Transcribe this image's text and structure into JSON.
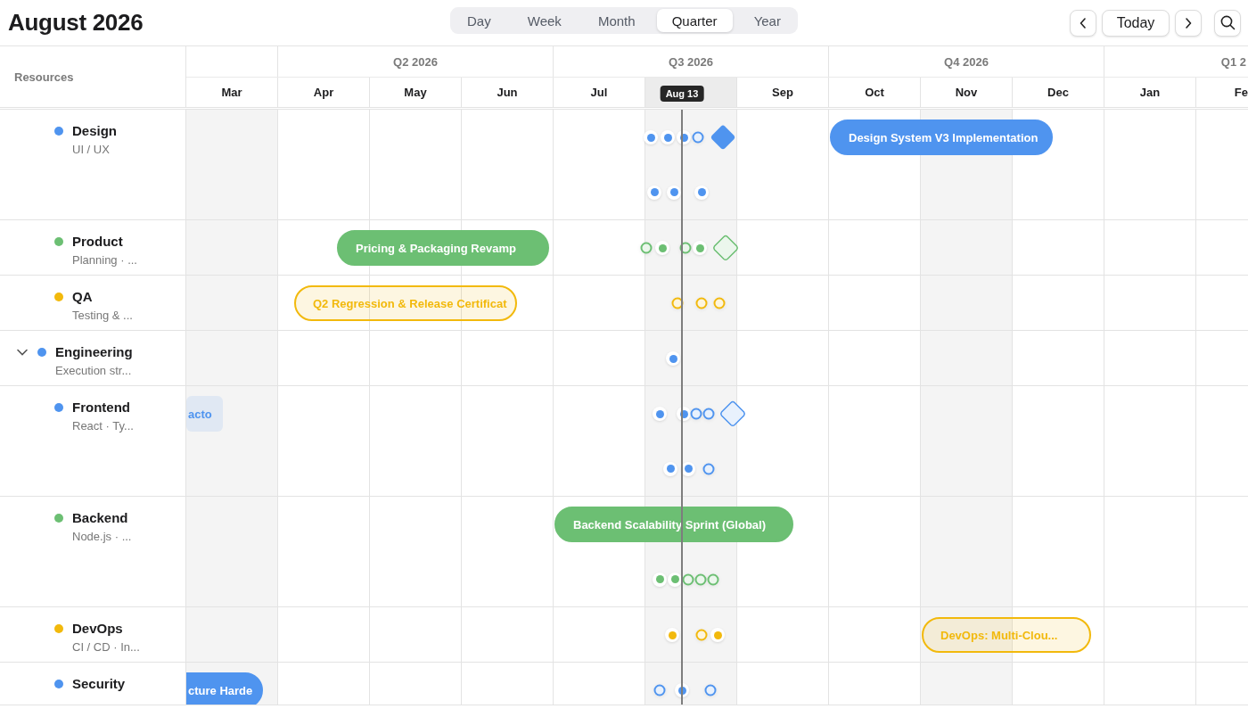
{
  "header": {
    "title": "August 2026"
  },
  "views": [
    {
      "label": "Day",
      "selected": false
    },
    {
      "label": "Week",
      "selected": false
    },
    {
      "label": "Month",
      "selected": false
    },
    {
      "label": "Quarter",
      "selected": true
    },
    {
      "label": "Year",
      "selected": false
    }
  ],
  "nav": {
    "today": "Today"
  },
  "resources_heading": "Resources",
  "quarters": [
    {
      "months": [
        {
          "label": "Mar",
          "shaded": true,
          "current": false
        }
      ]
    },
    {
      "label": "Q2 2026",
      "months": [
        {
          "label": "Apr",
          "shaded": false,
          "current": false
        },
        {
          "label": "May",
          "shaded": false,
          "current": false
        },
        {
          "label": "Jun",
          "shaded": false,
          "current": false
        }
      ]
    },
    {
      "label": "Q3 2026",
      "months": [
        {
          "label": "Jul",
          "shaded": false,
          "current": false
        },
        {
          "shaded": true,
          "current": true
        },
        {
          "label": "Sep",
          "shaded": false,
          "current": false
        }
      ]
    },
    {
      "label": "Q4 2026",
      "months": [
        {
          "label": "Oct",
          "shaded": false,
          "current": false
        },
        {
          "label": "Nov",
          "shaded": true,
          "current": false
        },
        {
          "label": "Dec",
          "shaded": false,
          "current": false
        }
      ]
    },
    {
      "label": "Q1 2",
      "months": [
        {
          "label": "Jan",
          "shaded": false,
          "current": false
        },
        {
          "label": "Fe",
          "shaded": false,
          "current": false
        }
      ]
    }
  ],
  "today": {
    "label": "Aug 13"
  },
  "resources": [
    {
      "name": "Design",
      "subtitle": "UI / UX",
      "color": "#4f94ef",
      "lanes": [
        {
          "bars": [
            {
              "label": "Design System V3 Implementation",
              "kind": "solid"
            }
          ],
          "markers": [
            {
              "kind": "dot"
            },
            {
              "kind": "dot"
            },
            {
              "kind": "dot"
            },
            {
              "kind": "ring"
            },
            {
              "kind": "diamond"
            }
          ]
        },
        {
          "markers": [
            {
              "kind": "dot"
            },
            {
              "kind": "dot"
            },
            {
              "kind": "dot"
            }
          ]
        }
      ]
    },
    {
      "name": "Product",
      "subtitle": "Planning · ...",
      "color": "#6cbf73",
      "lanes": [
        {
          "bars": [
            {
              "label": "Pricing & Packaging Revamp",
              "kind": "solid"
            }
          ],
          "markers": [
            {
              "kind": "ring"
            },
            {
              "kind": "dot"
            },
            {
              "kind": "ring"
            },
            {
              "kind": "dot"
            },
            {
              "kind": "diamond-outline"
            }
          ]
        }
      ]
    },
    {
      "name": "QA",
      "subtitle": "Testing & ...",
      "color": "#f2b90c",
      "lanes": [
        {
          "bars": [
            {
              "label": "Q2 Regression & Release Certificat",
              "kind": "outline"
            }
          ],
          "markers": [
            {
              "kind": "ring"
            },
            {
              "kind": "ring"
            },
            {
              "kind": "ring"
            }
          ]
        }
      ]
    },
    {
      "name": "Engineering",
      "subtitle": "Execution str...",
      "color": "#4f94ef",
      "expanded": true,
      "lanes": [
        {
          "markers": [
            {
              "kind": "dot"
            }
          ]
        }
      ],
      "children": [
        {
          "name": "Frontend",
          "subtitle": "React · Ty...",
          "color": "#4f94ef",
          "lanes": [
            {
              "bars": [
                {
                  "label": "acto",
                  "kind": "soft"
                }
              ],
              "markers": [
                {
                  "kind": "dot"
                },
                {
                  "kind": "dot"
                },
                {
                  "kind": "ring"
                },
                {
                  "kind": "ring"
                },
                {
                  "kind": "diamond-outline"
                }
              ]
            },
            {
              "markers": [
                {
                  "kind": "dot"
                },
                {
                  "kind": "dot"
                },
                {
                  "kind": "ring"
                }
              ]
            }
          ]
        },
        {
          "name": "Backend",
          "subtitle": "Node.js · ...",
          "color": "#6cbf73",
          "lanes": [
            {
              "bars": [
                {
                  "label": "Backend Scalability Sprint (Global)",
                  "kind": "solid"
                }
              ]
            },
            {
              "markers": [
                {
                  "kind": "dot"
                },
                {
                  "kind": "dot"
                },
                {
                  "kind": "ring"
                },
                {
                  "kind": "ring"
                },
                {
                  "kind": "ring"
                }
              ]
            }
          ]
        },
        {
          "name": "DevOps",
          "subtitle": "CI / CD · In...",
          "color": "#f2b90c",
          "lanes": [
            {
              "bars": [
                {
                  "label": "DevOps: Multi-Clou...",
                  "kind": "outline"
                }
              ],
              "markers": [
                {
                  "kind": "dot"
                },
                {
                  "kind": "ring"
                },
                {
                  "kind": "dot"
                }
              ]
            }
          ]
        },
        {
          "name": "Security",
          "color": "#4f94ef",
          "lanes": [
            {
              "bars": [
                {
                  "label": "cture Harde",
                  "kind": "solid"
                }
              ],
              "markers": [
                {
                  "kind": "ring"
                },
                {
                  "kind": "dot"
                },
                {
                  "kind": "ring"
                }
              ]
            }
          ]
        }
      ]
    }
  ]
}
